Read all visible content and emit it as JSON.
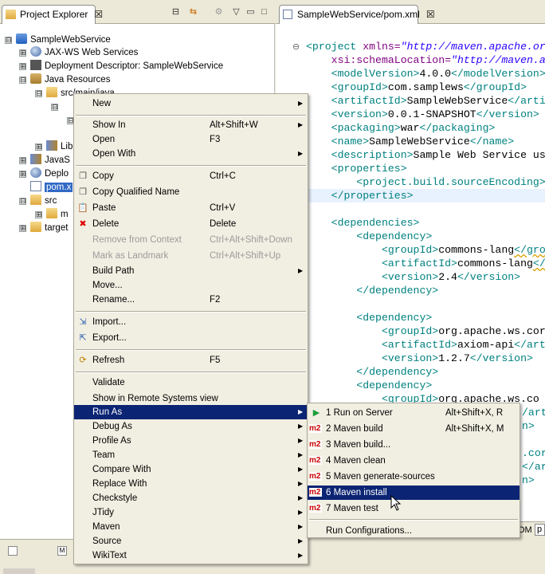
{
  "explorer": {
    "tab_title": "Project Explorer",
    "tab_close": "☒",
    "tree": [
      {
        "label": "SampleWebService",
        "icon": "project-icon",
        "expander": "⊟"
      },
      {
        "label": "JAX-WS Web Services",
        "icon": "web-services-icon",
        "expander": "⊞"
      },
      {
        "label": "Deployment Descriptor: SampleWebService",
        "icon": "deployment-descriptor-icon",
        "expander": "⊞"
      },
      {
        "label": "Java Resources",
        "icon": "java-resources-icon",
        "expander": "⊟"
      },
      {
        "label": "src/main/java",
        "icon": "source-folder-icon",
        "expander": "⊟"
      },
      {
        "label": "Lib",
        "icon": "library-icon",
        "expander": "⊞"
      },
      {
        "label": "JavaS",
        "icon": "jar-icon",
        "expander": "⊞"
      },
      {
        "label": "Deplo",
        "icon": "deployed-resources-icon",
        "expander": "⊞"
      },
      {
        "label": "pom.x",
        "icon": "xml-file-icon",
        "expander": ""
      },
      {
        "label": "src",
        "icon": "folder-icon",
        "expander": "⊟"
      },
      {
        "label": "m",
        "icon": "folder-icon",
        "expander": "⊞"
      },
      {
        "label": "target",
        "icon": "folder-icon",
        "expander": "⊞"
      }
    ]
  },
  "editor": {
    "tab_title": "SampleWebService/pom.xml",
    "tab_close": "☒",
    "fold_marker": "⊖",
    "lines": [
      {
        "t": "<project ",
        "a": "xmlns=",
        "v": "\"http://maven.apache.or"
      },
      {
        "t": "    ",
        "a": "xsi:schemaLocation=",
        "v": "\"http://maven.a"
      },
      {
        "t": "    <modelVersion>",
        "x": "4.0.0",
        "c": "</modelVersion>"
      },
      {
        "t": "    <groupId>",
        "x": "com.samplews",
        "c": "</groupId>"
      },
      {
        "t": "    <artifactId>",
        "x": "SampleWebService",
        "c": "</arti"
      },
      {
        "t": "    <version>",
        "x": "0.0.1-SNAPSHOT",
        "c": "</version>"
      },
      {
        "t": "    <packaging>",
        "x": "war",
        "c": "</packaging>"
      },
      {
        "t": "    <name>",
        "x": "SampleWebService",
        "c": "</name>"
      },
      {
        "t": "    <description>",
        "x": "Sample Web Service us",
        "c": ""
      },
      {
        "t": "    <properties>",
        "x": "",
        "c": ""
      },
      {
        "t": "        <project.build.sourceEncoding>",
        "x": "",
        "c": ""
      },
      {
        "t": "    </properties>",
        "x": "",
        "c": ""
      },
      {
        "t": "",
        "x": "",
        "c": ""
      },
      {
        "t": "    <dependencies>",
        "x": "",
        "c": ""
      },
      {
        "t": "        <dependency>",
        "x": "",
        "c": ""
      },
      {
        "t": "            <groupId>",
        "x": "commons-lang",
        "c": "</group"
      },
      {
        "t": "            <artifactId>",
        "x": "commons-lang",
        "c": "</"
      },
      {
        "t": "            <version>",
        "x": "2.4",
        "c": "</version>"
      },
      {
        "t": "        </dependency>",
        "x": "",
        "c": ""
      },
      {
        "t": "",
        "x": "",
        "c": ""
      },
      {
        "t": "        <dependency>",
        "x": "",
        "c": ""
      },
      {
        "t": "            <groupId>",
        "x": "org.apache.ws.cor",
        "c": ""
      },
      {
        "t": "            <artifactId>",
        "x": "axiom-api",
        "c": "</art"
      },
      {
        "t": "            <version>",
        "x": "1.2.7",
        "c": "</version>"
      },
      {
        "t": "        </dependency>",
        "x": "",
        "c": ""
      },
      {
        "t": "        <dependency>",
        "x": "",
        "c": ""
      },
      {
        "t": "            <groupId>",
        "x": "org.apache.ws.co",
        "c": ""
      },
      {
        "t": "",
        "x": "",
        "c": "/art"
      },
      {
        "t": "",
        "x": "",
        "c": "n>"
      },
      {
        "t": "",
        "x": "",
        "c": ""
      },
      {
        "t": "",
        "x": "",
        "c": ".cor"
      },
      {
        "t": "",
        "x": "",
        "c": "</ar"
      },
      {
        "t": "",
        "x": "",
        "c": "n>"
      }
    ],
    "bottom_tab_1": "OM",
    "bottom_tab_2": "p"
  },
  "context_menu": {
    "items": [
      {
        "label": "New",
        "shortcut": "",
        "submenu": true,
        "icon": "",
        "disabled": false
      },
      {
        "sep": true
      },
      {
        "label": "Show In",
        "shortcut": "Alt+Shift+W",
        "submenu": true,
        "icon": "",
        "disabled": false
      },
      {
        "label": "Open",
        "shortcut": "F3",
        "submenu": false,
        "icon": "",
        "disabled": false
      },
      {
        "label": "Open With",
        "shortcut": "",
        "submenu": true,
        "icon": "",
        "disabled": false
      },
      {
        "sep": true
      },
      {
        "label": "Copy",
        "shortcut": "Ctrl+C",
        "submenu": false,
        "icon": "copy-icon",
        "disabled": false
      },
      {
        "label": "Copy Qualified Name",
        "shortcut": "",
        "submenu": false,
        "icon": "copy-icon",
        "disabled": false
      },
      {
        "label": "Paste",
        "shortcut": "Ctrl+V",
        "submenu": false,
        "icon": "paste-icon",
        "disabled": false
      },
      {
        "label": "Delete",
        "shortcut": "Delete",
        "submenu": false,
        "icon": "delete-icon",
        "disabled": false
      },
      {
        "label": "Remove from Context",
        "shortcut": "Ctrl+Alt+Shift+Down",
        "submenu": false,
        "icon": "",
        "disabled": true
      },
      {
        "label": "Mark as Landmark",
        "shortcut": "Ctrl+Alt+Shift+Up",
        "submenu": false,
        "icon": "",
        "disabled": true
      },
      {
        "label": "Build Path",
        "shortcut": "",
        "submenu": true,
        "icon": "",
        "disabled": false
      },
      {
        "label": "Move...",
        "shortcut": "",
        "submenu": false,
        "icon": "",
        "disabled": false
      },
      {
        "label": "Rename...",
        "shortcut": "F2",
        "submenu": false,
        "icon": "",
        "disabled": false
      },
      {
        "sep": true
      },
      {
        "label": "Import...",
        "shortcut": "",
        "submenu": false,
        "icon": "import-icon",
        "disabled": false
      },
      {
        "label": "Export...",
        "shortcut": "",
        "submenu": false,
        "icon": "export-icon",
        "disabled": false
      },
      {
        "sep": true
      },
      {
        "label": "Refresh",
        "shortcut": "F5",
        "submenu": false,
        "icon": "refresh-icon",
        "disabled": false
      },
      {
        "sep": true
      },
      {
        "label": "Validate",
        "shortcut": "",
        "submenu": false,
        "icon": "",
        "disabled": false
      },
      {
        "label": "Show in Remote Systems view",
        "shortcut": "",
        "submenu": false,
        "icon": "",
        "disabled": false
      },
      {
        "label": "Run As",
        "shortcut": "",
        "submenu": true,
        "icon": "",
        "disabled": false,
        "highlight": true
      },
      {
        "label": "Debug As",
        "shortcut": "",
        "submenu": true,
        "icon": "",
        "disabled": false
      },
      {
        "label": "Profile As",
        "shortcut": "",
        "submenu": true,
        "icon": "",
        "disabled": false
      },
      {
        "label": "Team",
        "shortcut": "",
        "submenu": true,
        "icon": "",
        "disabled": false
      },
      {
        "label": "Compare With",
        "shortcut": "",
        "submenu": true,
        "icon": "",
        "disabled": false
      },
      {
        "label": "Replace With",
        "shortcut": "",
        "submenu": true,
        "icon": "",
        "disabled": false
      },
      {
        "label": "Checkstyle",
        "shortcut": "",
        "submenu": true,
        "icon": "",
        "disabled": false
      },
      {
        "label": "JTidy",
        "shortcut": "",
        "submenu": true,
        "icon": "",
        "disabled": false
      },
      {
        "label": "Maven",
        "shortcut": "",
        "submenu": true,
        "icon": "",
        "disabled": false
      },
      {
        "label": "Source",
        "shortcut": "",
        "submenu": true,
        "icon": "",
        "disabled": false
      },
      {
        "label": "WikiText",
        "shortcut": "",
        "submenu": true,
        "icon": "",
        "disabled": false
      }
    ]
  },
  "run_as_menu": {
    "items": [
      {
        "label": "1 Run on Server",
        "shortcut": "Alt+Shift+X, R",
        "icon": "run-on-server-icon"
      },
      {
        "label": "2 Maven build",
        "shortcut": "Alt+Shift+X, M",
        "icon": "m2"
      },
      {
        "label": "3 Maven build...",
        "shortcut": "",
        "icon": "m2"
      },
      {
        "label": "4 Maven clean",
        "shortcut": "",
        "icon": "m2"
      },
      {
        "label": "5 Maven generate-sources",
        "shortcut": "",
        "icon": "m2"
      },
      {
        "label": "6 Maven install",
        "shortcut": "",
        "icon": "m2",
        "highlight": true
      },
      {
        "label": "7 Maven test",
        "shortcut": "",
        "icon": "m2"
      },
      {
        "sep": true
      },
      {
        "label": "Run Configurations...",
        "shortcut": "",
        "icon": ""
      }
    ],
    "m2_badge": "m2"
  },
  "colors": {
    "menu_highlight": "#0b2473",
    "tree_selection": "#316ac5",
    "menu_bg": "#f1efe2"
  }
}
